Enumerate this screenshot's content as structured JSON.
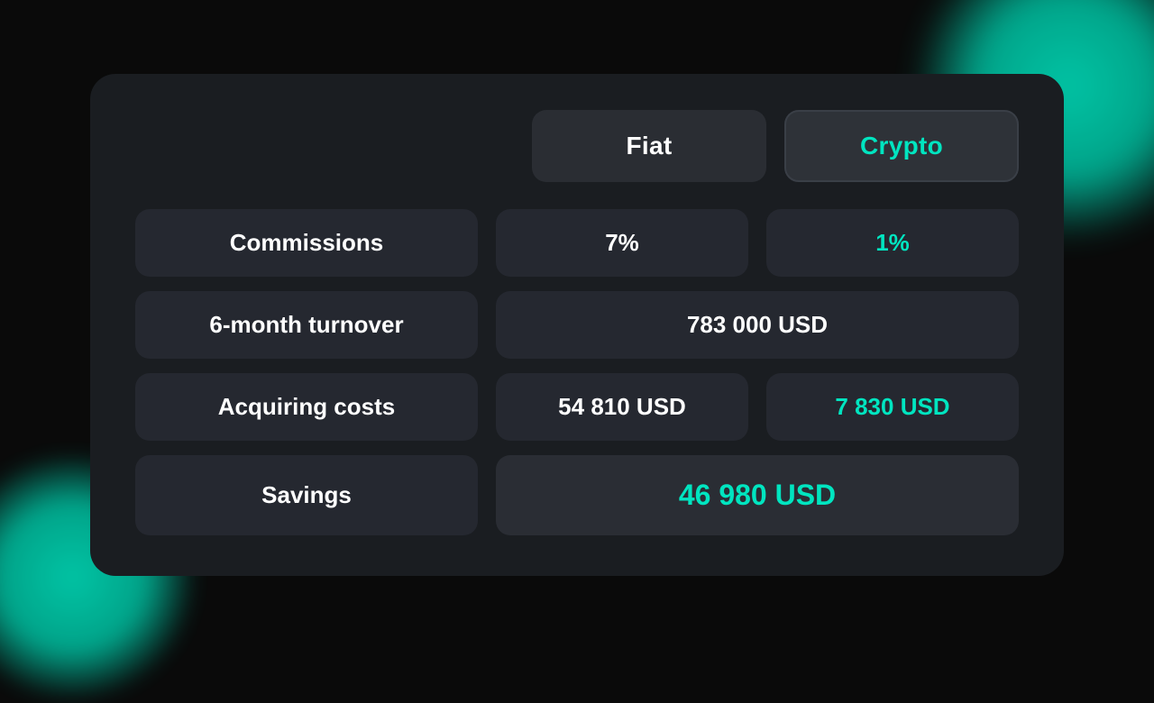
{
  "background": {
    "color": "#0a0a0a",
    "blob_color": "#00e5c0"
  },
  "card": {
    "tabs": {
      "fiat": {
        "label": "Fiat"
      },
      "crypto": {
        "label": "Crypto"
      }
    },
    "rows": [
      {
        "id": "commissions",
        "label": "Commissions",
        "fiat_value": "7%",
        "crypto_value": "1%",
        "fiat_color": "white",
        "crypto_color": "teal",
        "span": false
      },
      {
        "id": "turnover",
        "label": "6-month turnover",
        "value": "783 000 USD",
        "span": true
      },
      {
        "id": "acquiring",
        "label": "Acquiring costs",
        "fiat_value": "54 810 USD",
        "crypto_value": "7 830 USD",
        "fiat_color": "white",
        "crypto_color": "teal",
        "span": false
      },
      {
        "id": "savings",
        "label": "Savings",
        "value": "46 980 USD",
        "span": true,
        "highlight": true
      }
    ]
  }
}
